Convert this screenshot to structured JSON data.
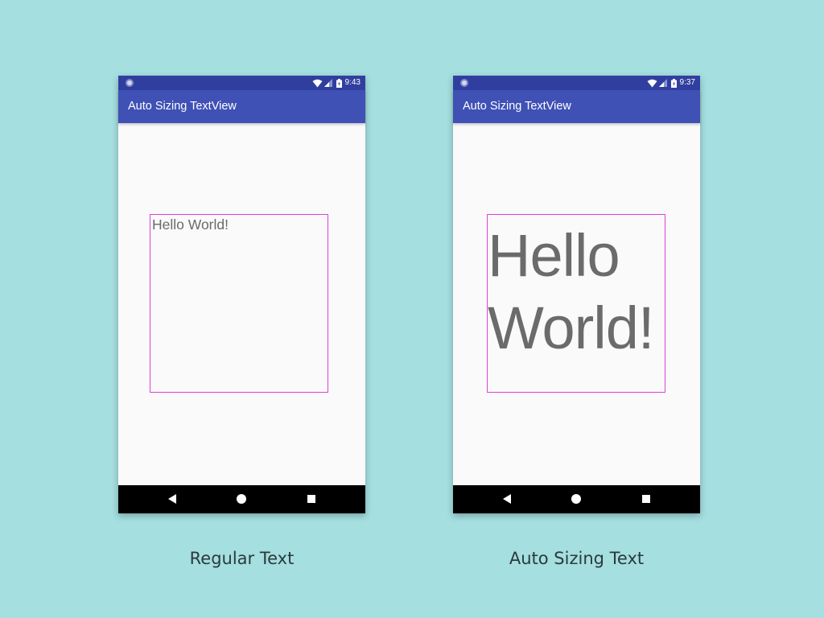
{
  "left_screen": {
    "status_time": "9:43",
    "app_title": "Auto Sizing TextView",
    "text_content": "Hello World!",
    "caption": "Regular Text"
  },
  "right_screen": {
    "status_time": "9:37",
    "app_title": "Auto Sizing TextView",
    "text_line1": "Hello",
    "text_line2": "World!",
    "caption": "Auto Sizing Text"
  },
  "icons": {
    "status_left": "notification-dot-icon",
    "wifi": "wifi-icon",
    "signal": "signal-icon",
    "battery": "battery-charging-icon",
    "nav_back": "back-triangle-icon",
    "nav_home": "home-circle-icon",
    "nav_recents": "recents-square-icon"
  },
  "colors": {
    "background": "#a5dfe0",
    "status_bar": "#303f9f",
    "app_bar": "#3f51b5",
    "content_bg": "#fafafa",
    "text_box_border": "#e040d8",
    "text": "#6b6b6b",
    "nav_bar": "#000000"
  }
}
